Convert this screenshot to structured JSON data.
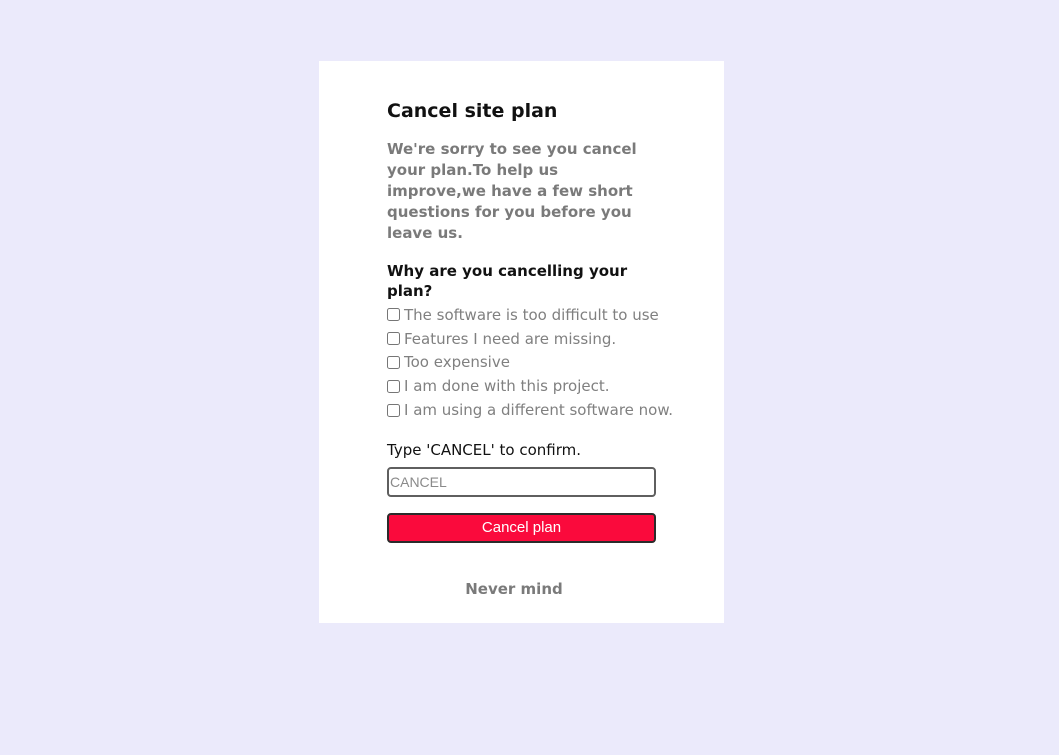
{
  "dialog": {
    "title": "Cancel site plan",
    "intro": "We're sorry to see you cancel your plan.To help us improve,we have a few short questions for you before you leave us.",
    "question": "Why are you cancelling your plan?",
    "options": [
      {
        "label": "The software is too difficult to use",
        "checked": false
      },
      {
        "label": "Features I need are missing.",
        "checked": false
      },
      {
        "label": "Too expensive",
        "checked": false
      },
      {
        "label": "I am done with this project.",
        "checked": false
      },
      {
        "label": "I am using a different software now.",
        "checked": false
      }
    ],
    "confirm_label": "Type 'CANCEL' to confirm.",
    "confirm_input": {
      "value": "",
      "placeholder": "CANCEL"
    },
    "cancel_button_label": "Cancel plan",
    "never_mind_label": "Never mind"
  },
  "colors": {
    "background": "#ebeafb",
    "card": "#ffffff",
    "danger": "#fa0a3c",
    "muted_text": "#7a7a7a"
  }
}
